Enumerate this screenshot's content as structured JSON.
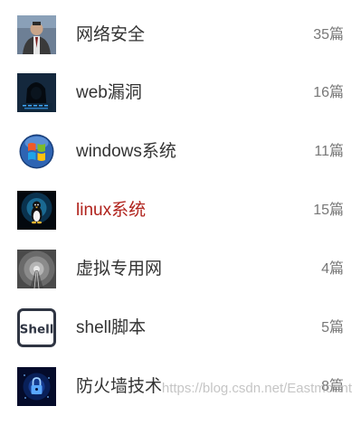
{
  "categories": [
    {
      "name": "网络安全",
      "count": "35篇",
      "icon": "person-portrait-icon"
    },
    {
      "name": "web漏洞",
      "count": "16篇",
      "icon": "hooded-hacker-icon"
    },
    {
      "name": "windows系统",
      "count": "11篇",
      "icon": "windows-logo-icon"
    },
    {
      "name": "linux系统",
      "count": "15篇",
      "icon": "linux-penguin-icon",
      "active": true
    },
    {
      "name": "虚拟专用网",
      "count": "4篇",
      "icon": "tunnel-icon"
    },
    {
      "name": "shell脚本",
      "count": "5篇",
      "icon": "shell-logo-icon"
    },
    {
      "name": "防火墙技术",
      "count": "8篇",
      "icon": "lock-icon"
    }
  ],
  "watermark": "https://blog.csdn.net/Eastmount",
  "colors": {
    "active": "#b0221c",
    "text": "#333333",
    "count": "#777777"
  }
}
